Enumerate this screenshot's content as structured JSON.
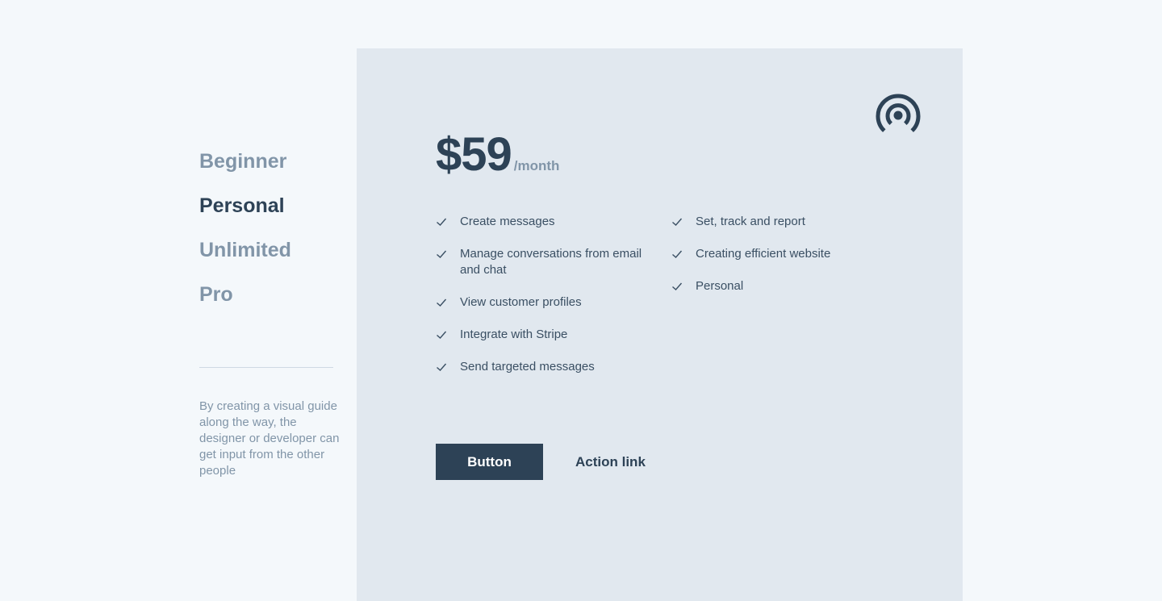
{
  "colors": {
    "background": "#f4f8fb",
    "panel": "#e1e8ef",
    "primary": "#2d4256",
    "muted": "#8195a8"
  },
  "plans": [
    {
      "label": "Beginner",
      "active": false
    },
    {
      "label": "Personal",
      "active": true
    },
    {
      "label": "Unlimited",
      "active": false
    },
    {
      "label": "Pro",
      "active": false
    }
  ],
  "description": "By creating a visual guide along the way, the designer or developer can get input from the other people",
  "brand_icon": "broadcast-icon",
  "price": {
    "amount": "$59",
    "period": "/month"
  },
  "features": {
    "column1": [
      "Create messages",
      "Manage conversations from email and chat",
      "View customer profiles",
      "Integrate with Stripe",
      "Send targeted messages"
    ],
    "column2": [
      "Set, track and report",
      "Creating efficient website",
      "Personal"
    ]
  },
  "actions": {
    "button_label": "Button",
    "link_label": "Action link"
  }
}
